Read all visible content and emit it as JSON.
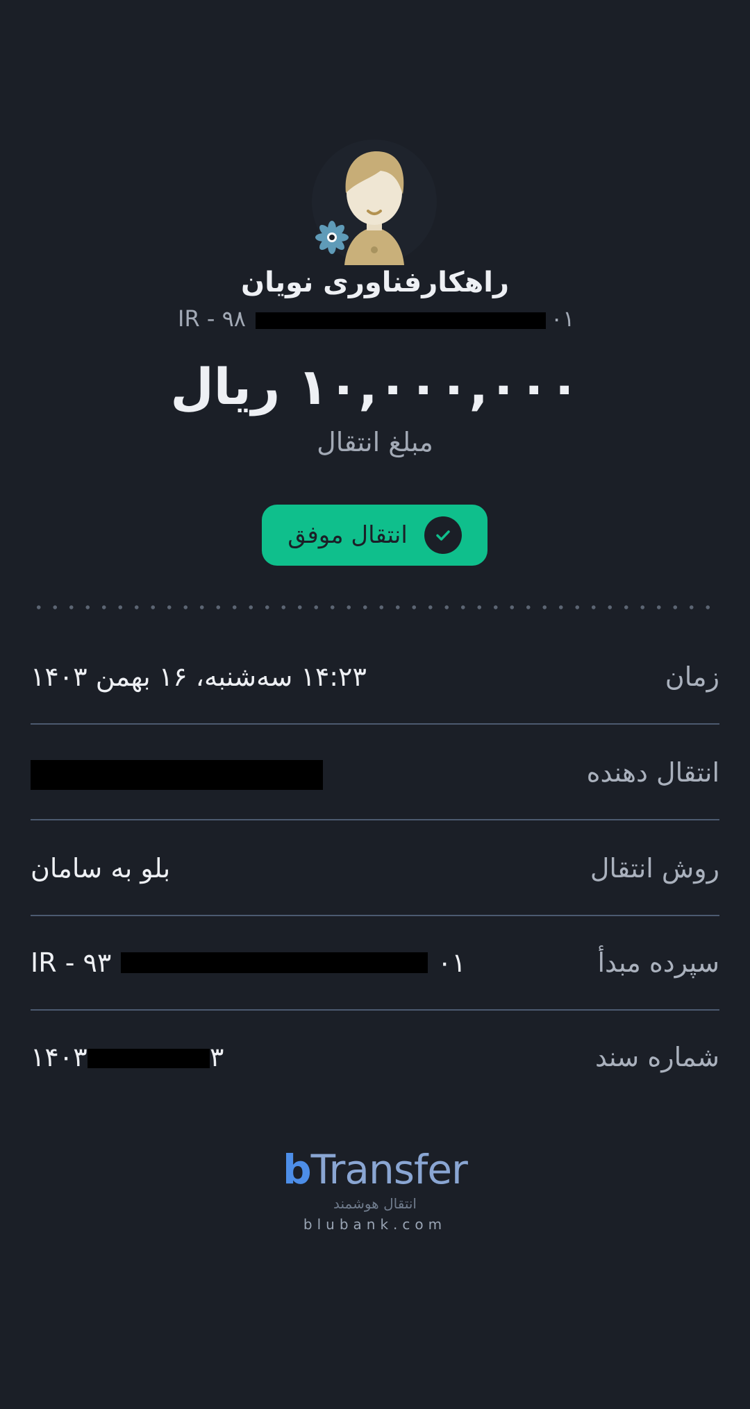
{
  "recipient": {
    "name": "راهکارفناوری نویان",
    "iban_prefix": "IR - ۹۸",
    "iban_suffix": "۰۱"
  },
  "amount": {
    "value": "۱۰,۰۰۰,۰۰۰ ریال",
    "label": "مبلغ انتقال"
  },
  "status": {
    "text": "انتقال موفق",
    "color": "#0fbf8c"
  },
  "details": {
    "time": {
      "label": "زمان",
      "value": "۱۴:۲۳ سه‌شنبه، ۱۶ بهمن ۱۴۰۳"
    },
    "sender": {
      "label": "انتقال دهنده"
    },
    "method": {
      "label": "روش انتقال",
      "value": "بلو به سامان"
    },
    "source_account": {
      "label": "سپرده مبدأ",
      "prefix": "IR - ۹۳",
      "suffix": "۰۱"
    },
    "document_number": {
      "label": "شماره سند",
      "prefix": "۱۴۰۳",
      "suffix": "۳"
    }
  },
  "brand": {
    "logo_b": "b",
    "logo_rest": "Transfer",
    "tagline": "انتقال هوشمند",
    "url": "blubank.com",
    "accent": "#4d8ee8"
  },
  "colors": {
    "background": "#1b1f27",
    "divider": "#4c5a70"
  }
}
